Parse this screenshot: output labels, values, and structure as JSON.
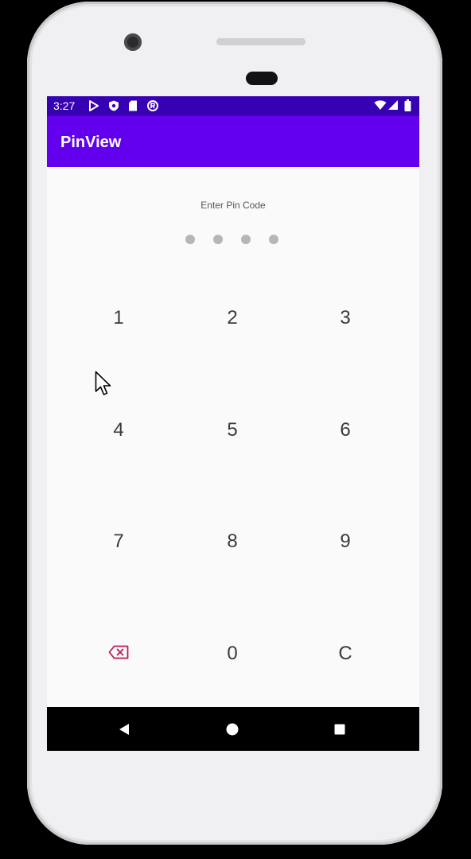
{
  "status_bar": {
    "time": "3:27",
    "left_icons": [
      "play-store-icon",
      "shield-icon",
      "sd-card-icon",
      "accessibility-icon"
    ],
    "right_icons": [
      "wifi-icon",
      "signal-icon",
      "battery-icon"
    ],
    "background": "#3700b3"
  },
  "app_bar": {
    "title": "PinView",
    "background": "#6200ee"
  },
  "pin_view": {
    "prompt": "Enter Pin Code",
    "dots_filled": 0,
    "dots_total": 4
  },
  "keypad": {
    "keys": [
      {
        "label": "1"
      },
      {
        "label": "2"
      },
      {
        "label": "3"
      },
      {
        "label": "4"
      },
      {
        "label": "5"
      },
      {
        "label": "6"
      },
      {
        "label": "7"
      },
      {
        "label": "8"
      },
      {
        "label": "9"
      },
      {
        "label": ""
      },
      {
        "label": "0"
      },
      {
        "label": "C"
      }
    ],
    "backspace_icon": "backspace-icon",
    "backspace_color": "#c2185b"
  },
  "nav_bar": {
    "buttons": [
      "back-icon",
      "home-icon",
      "recents-icon"
    ]
  }
}
